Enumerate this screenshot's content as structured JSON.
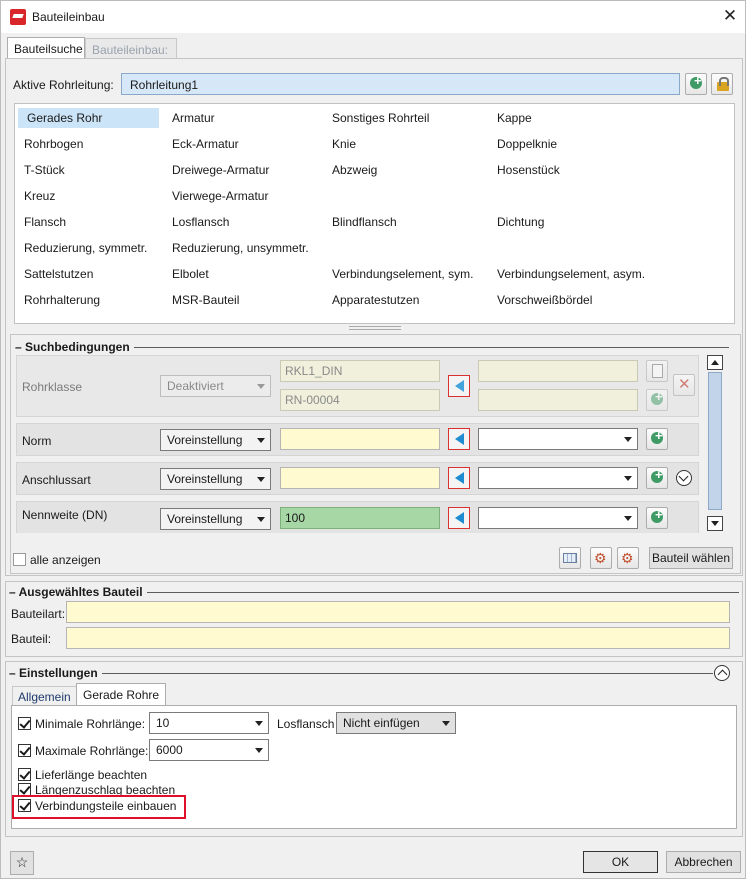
{
  "window": {
    "title": "Bauteileinbau"
  },
  "tabs": [
    {
      "label": "Bauteilsuche"
    },
    {
      "label": "Bauteileinbau:"
    }
  ],
  "pipeline": {
    "label": "Aktive Rohrleitung:",
    "value": "Rohrleitung1"
  },
  "parts": [
    [
      "Gerades Rohr",
      "Armatur",
      "Sonstiges Rohrteil",
      "Kappe"
    ],
    [
      "Rohrbogen",
      "Eck-Armatur",
      "Knie",
      "Doppelknie"
    ],
    [
      "T-Stück",
      "Dreiwege-Armatur",
      "Abzweig",
      "Hosenstück"
    ],
    [
      "Kreuz",
      "Vierwege-Armatur",
      "",
      ""
    ],
    [
      "Flansch",
      "Losflansch",
      "Blindflansch",
      "Dichtung"
    ],
    [
      "Reduzierung, symmetr.",
      "Reduzierung, unsymmetr.",
      "",
      ""
    ],
    [
      "Sattelstutzen",
      "Elbolet",
      "Verbindungselement, sym.",
      "Verbindungselement, asym."
    ],
    [
      "Rohrhalterung",
      "MSR-Bauteil",
      "Apparatestutzen",
      "Vorschweißbördel"
    ]
  ],
  "search": {
    "title": "Suchbedingungen",
    "rohrklasse": {
      "label": "Rohrklasse",
      "mode": "Deaktiviert",
      "value1": "RKL1_DIN",
      "value2": "RN-00004"
    },
    "norm": {
      "label": "Norm",
      "mode": "Voreinstellung",
      "value": ""
    },
    "anschlussart": {
      "label": "Anschlussart",
      "mode": "Voreinstellung",
      "value": ""
    },
    "nennweite": {
      "label": "Nennweite (DN)",
      "mode": "Voreinstellung",
      "value": "100"
    },
    "show_all": "alle anzeigen",
    "choose_button": "Bauteil wählen"
  },
  "selected": {
    "title": "Ausgewähltes Bauteil",
    "type_label": "Bauteilart:",
    "part_label": "Bauteil:"
  },
  "settings": {
    "title": "Einstellungen",
    "tabs": [
      {
        "label": "Allgemein"
      },
      {
        "label": "Gerade Rohre"
      }
    ],
    "min_length": {
      "label": "Minimale Rohrlänge:",
      "value": "10",
      "checked": true
    },
    "max_length": {
      "label": "Maximale Rohrlänge:",
      "value": "6000",
      "checked": true
    },
    "losflansch": {
      "label": "Losflansch",
      "value": "Nicht einfügen"
    },
    "lieferlaenge": {
      "label": "Lieferlänge beachten",
      "checked": true
    },
    "laengenzuschlag": {
      "label": "Längenzuschlag beachten",
      "checked": true
    },
    "verbindungsteile": {
      "label": "Verbindungsteile einbauen",
      "checked": true
    }
  },
  "footer": {
    "ok": "OK",
    "cancel": "Abbrechen"
  },
  "colors": {
    "selection": "#cce4f7",
    "pipeline_field": "#d6e8f8",
    "input_yellow": "#fffacf",
    "input_green": "#a7d7a5",
    "highlight": "#e0102a"
  }
}
